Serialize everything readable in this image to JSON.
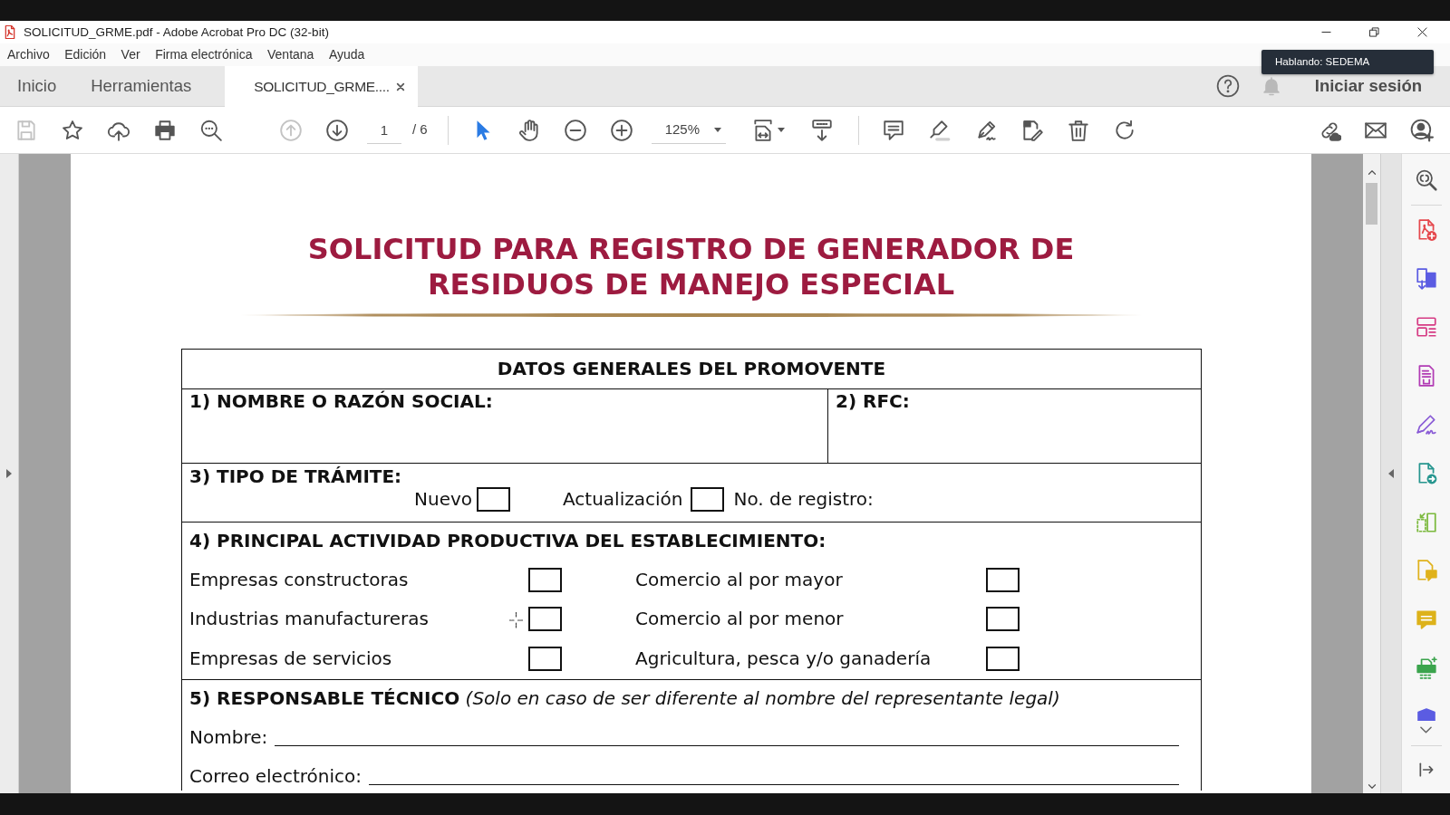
{
  "window": {
    "title": "SOLICITUD_GRME.pdf - Adobe Acrobat Pro DC (32-bit)"
  },
  "menu": [
    "Archivo",
    "Edición",
    "Ver",
    "Firma electrónica",
    "Ventana",
    "Ayuda"
  ],
  "tooltip": {
    "text": "Hablando: SEDEMA"
  },
  "tabs": [
    {
      "label": "Inicio",
      "kind": "nav",
      "selected": false
    },
    {
      "label": "Herramientas",
      "kind": "nav",
      "selected": false
    },
    {
      "label": "SOLICITUD_GRME....",
      "kind": "document",
      "selected": true
    }
  ],
  "account": {
    "sign_in": "Iniciar sesión"
  },
  "toolbar": {
    "groups": [
      {
        "divider": false,
        "items": [
          {
            "kind": "save",
            "disabled": true,
            "selected": false
          },
          {
            "kind": "bookmark",
            "disabled": false,
            "selected": false
          },
          {
            "kind": "upload",
            "disabled": false,
            "selected": false
          },
          {
            "kind": "print",
            "disabled": false,
            "selected": false
          },
          {
            "kind": "find",
            "disabled": false,
            "selected": false
          }
        ]
      },
      {
        "divider": false,
        "items": [
          {
            "kind": "page-up",
            "disabled": true,
            "selected": false
          },
          {
            "kind": "page-down",
            "disabled": false,
            "selected": false
          },
          {
            "kind": "page-field",
            "value": "1",
            "total": "/ 6"
          }
        ]
      },
      {
        "divider": true,
        "items": [
          {
            "kind": "select",
            "disabled": false,
            "selected": true
          },
          {
            "kind": "hand",
            "disabled": false,
            "selected": false
          },
          {
            "kind": "zoom-out",
            "disabled": false,
            "selected": false
          },
          {
            "kind": "zoom-in",
            "disabled": false,
            "selected": false
          },
          {
            "kind": "zoom-field",
            "value": "125%"
          },
          {
            "kind": "fit-page",
            "disabled": false,
            "selected": false
          },
          {
            "kind": "scroll-mode",
            "disabled": false,
            "selected": false
          }
        ]
      },
      {
        "divider": true,
        "items": [
          {
            "kind": "comment",
            "disabled": false,
            "selected": false
          },
          {
            "kind": "highlight",
            "disabled": false,
            "selected": false
          },
          {
            "kind": "sign",
            "disabled": false,
            "selected": false
          },
          {
            "kind": "edit",
            "disabled": false,
            "selected": false
          },
          {
            "kind": "delete",
            "disabled": false,
            "selected": false
          },
          {
            "kind": "rotate",
            "disabled": false,
            "selected": false
          }
        ]
      }
    ],
    "end_items": [
      {
        "kind": "share-link",
        "disabled": false,
        "selected": false
      },
      {
        "kind": "email",
        "disabled": false,
        "selected": false
      },
      {
        "kind": "add-user",
        "disabled": false,
        "selected": false
      }
    ]
  },
  "document": {
    "title": "SOLICITUD PARA REGISTRO DE GENERADOR DE RESIDUOS DE MANEJO ESPECIAL",
    "form": {
      "header": "DATOS GENERALES DEL PROMOVENTE",
      "name_fields": [
        {
          "label": "1) NOMBRE O RAZÓN SOCIAL:"
        },
        {
          "label": "2) RFC:"
        }
      ],
      "tramite": {
        "label": "3) TIPO DE TRÁMITE:",
        "options": [
          {
            "label": "Nuevo",
            "checked": false
          },
          {
            "label": "Actualización",
            "checked": false
          }
        ],
        "registro": "No. de registro:"
      },
      "actividad": {
        "label": "4) PRINCIPAL ACTIVIDAD PRODUCTIVA DEL ESTABLECIMIENTO:",
        "options": [
          {
            "label": "Empresas constructoras",
            "checked": false
          },
          {
            "label": "Comercio al por mayor",
            "checked": false
          },
          {
            "label": "Industrias manufactureras",
            "checked": false
          },
          {
            "label": "Comercio al por menor",
            "checked": false
          },
          {
            "label": "Empresas de servicios",
            "checked": false
          },
          {
            "label": "Agricultura, pesca y/o ganadería",
            "checked": false
          }
        ]
      },
      "responsable": {
        "label": "**5) RESPONSABLE TÉCNICO** *(Solo en caso de ser diferente al nombre del representante legal)*",
        "fields": [
          {
            "label": "Nombre:"
          },
          {
            "label": "Correo electrónico:"
          }
        ]
      }
    }
  },
  "right_pane": {
    "tools": [
      {
        "kind": "zoom-text",
        "color": "#555555"
      },
      {
        "kind": "create-pdf",
        "color": "#e5484d"
      },
      {
        "kind": "combine",
        "color": "#5b5ce2"
      },
      {
        "kind": "organize",
        "color": "#d63b84"
      },
      {
        "kind": "export",
        "color": "#b13bb4"
      },
      {
        "kind": "fill-sign",
        "color": "#8a5cd6"
      },
      {
        "kind": "send",
        "color": "#27968f"
      },
      {
        "kind": "crop",
        "color": "#7bb93d"
      },
      {
        "kind": "comment-doc",
        "color": "#e0b21c"
      },
      {
        "kind": "comment",
        "color": "#ddb21a"
      },
      {
        "kind": "scan",
        "color": "#3ba44d"
      }
    ],
    "cut_off_tool": {
      "kind": "protect",
      "color": "#5b5ce2"
    }
  }
}
